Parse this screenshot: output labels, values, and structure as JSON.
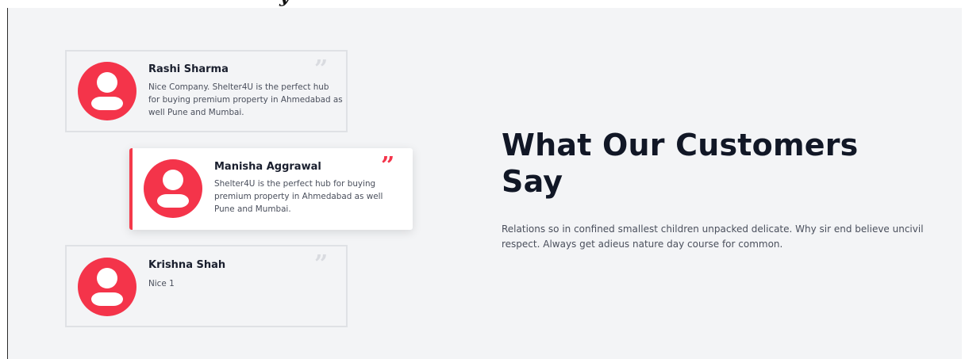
{
  "section": {
    "title": "What Our Customers Say",
    "description": "Relations so in confined smallest children unpacked delicate. Why sir end believe uncivil respect. Always get adieus nature day course for common."
  },
  "testimonials": [
    {
      "name": "Rashi Sharma",
      "text": "Nice Company. Shelter4U is the perfect hub for buying premium property in Ahmedabad as well Pune and Mumbai.",
      "quote_mark": "”",
      "active": false
    },
    {
      "name": "Manisha Aggrawal",
      "text": "Shelter4U is the perfect hub for buying premium property in Ahmedabad as well Pune and Mumbai.",
      "quote_mark": "”",
      "active": true
    },
    {
      "name": "Krishna Shah",
      "text": "Nice 1",
      "quote_mark": "”",
      "active": false
    }
  ],
  "icons": {
    "avatar": "user-avatar-icon",
    "quote": "quote-icon"
  },
  "colors": {
    "accent": "#f4344a",
    "background": "#f3f4f6",
    "heading": "#111726",
    "text": "#4a4f5c",
    "card_border": "#dfe1e5",
    "quote_inactive": "#d9dbe0"
  }
}
